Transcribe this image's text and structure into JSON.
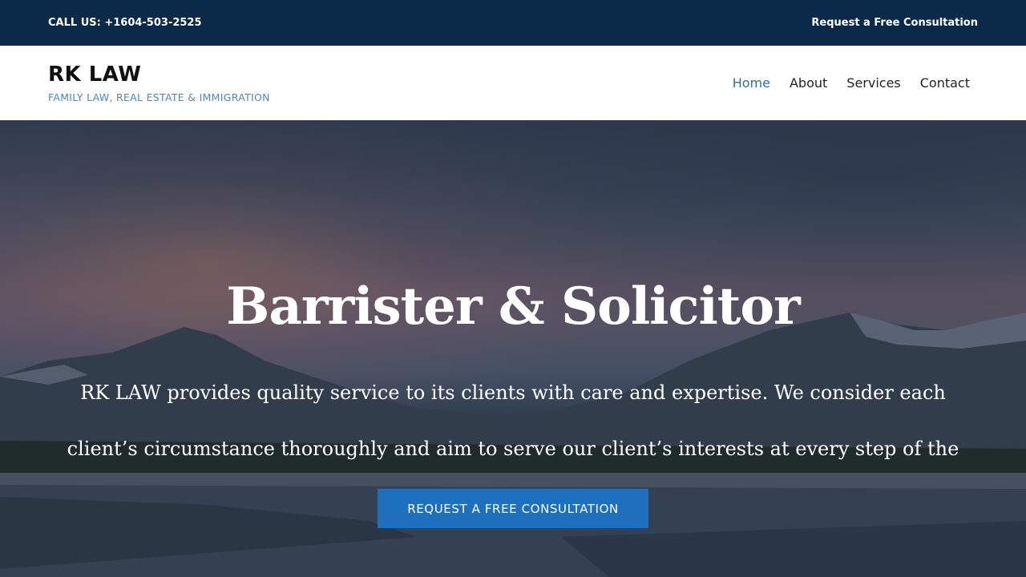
{
  "topbar": {
    "call": "CALL US: +1604-503-2525",
    "cta_link": "Request a Free Consultation"
  },
  "header": {
    "brand_name": "RK LAW",
    "tagline": "FAMILY LAW, REAL ESTATE & IMMIGRATION",
    "nav": [
      {
        "label": "Home",
        "active": true
      },
      {
        "label": "About",
        "active": false
      },
      {
        "label": "Services",
        "active": false
      },
      {
        "label": "Contact",
        "active": false
      }
    ]
  },
  "hero": {
    "title": "Barrister & Solicitor",
    "description": "RK LAW provides quality service to its clients with care and expertise. We consider each client’s circumstance thoroughly and aim to serve our client’s interests at every step of the way.",
    "button_label": "REQUEST A FREE CONSULTATION"
  },
  "colors": {
    "topbar_bg": "#0b2a4a",
    "accent": "#1f6fbf",
    "tagline": "#4a86c8",
    "nav_active": "#2c6db0"
  }
}
